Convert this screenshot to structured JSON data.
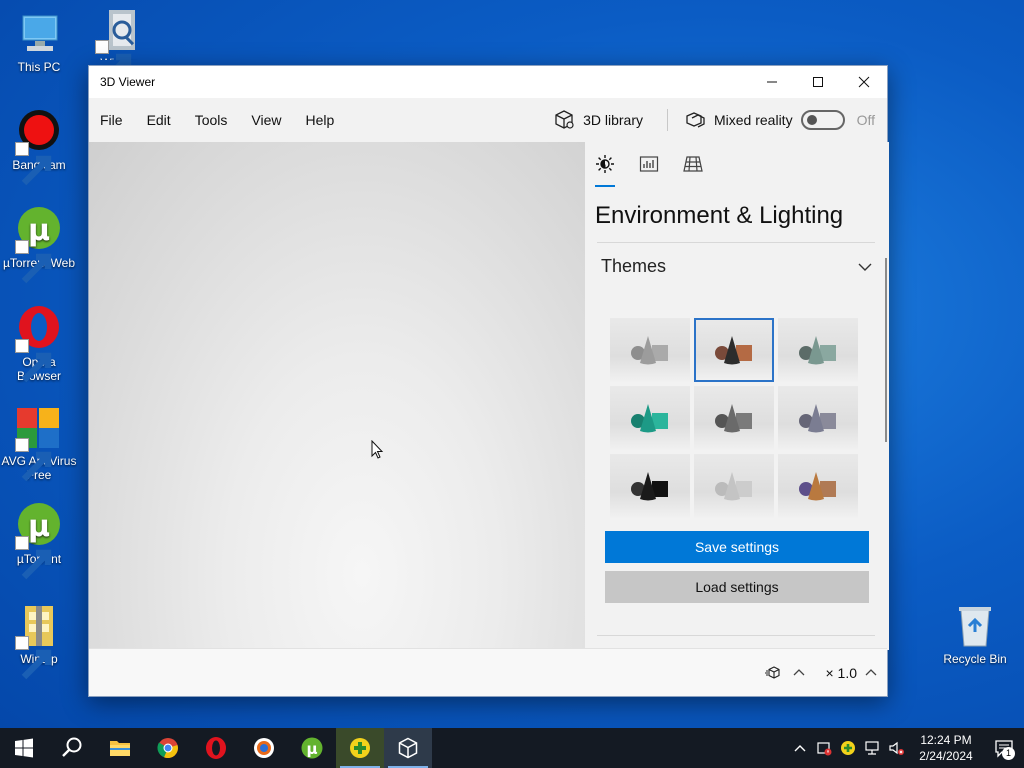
{
  "desktop": {
    "icons": [
      {
        "label": "This PC"
      },
      {
        "label": "WinZip"
      },
      {
        "label": "Bandicam"
      },
      {
        "label": "µTorrent Web"
      },
      {
        "label": "Opera Browser"
      },
      {
        "label": "AVG AntiVirus Free"
      },
      {
        "label": "µTorrent"
      },
      {
        "label": "WinZip"
      },
      {
        "label": "Recycle Bin"
      }
    ]
  },
  "window": {
    "title": "3D Viewer",
    "menu": [
      "File",
      "Edit",
      "Tools",
      "View",
      "Help"
    ],
    "library_label": "3D library",
    "mixed_reality_label": "Mixed reality",
    "toggle_state": "Off"
  },
  "panel": {
    "title": "Environment & Lighting",
    "section": "Themes",
    "save_label": "Save settings",
    "load_label": "Load settings",
    "selected_theme": 2,
    "themes": [
      {
        "primary": "#9c9c9c",
        "secondary": "#aaaaaa",
        "accent": "#8e8e8e"
      },
      {
        "primary": "#2c2c2c",
        "secondary": "#b46a44",
        "accent": "#7a4a3a"
      },
      {
        "primary": "#7a9890",
        "secondary": "#8aa8a0",
        "accent": "#5c6c68"
      },
      {
        "primary": "#1d9a86",
        "secondary": "#2bb59c",
        "accent": "#18806f"
      },
      {
        "primary": "#6a6a6a",
        "secondary": "#7a7a7a",
        "accent": "#555555"
      },
      {
        "primary": "#7b7d92",
        "secondary": "#8a8a9a",
        "accent": "#666677"
      },
      {
        "primary": "#1a1a1a",
        "secondary": "#111111",
        "accent": "#333333"
      },
      {
        "primary": "#c4c4c4",
        "secondary": "#cccccc",
        "accent": "#bbbbbb"
      },
      {
        "primary": "#b9793f",
        "secondary": "#b07a55",
        "accent": "#5d4f8a"
      }
    ]
  },
  "statusbar": {
    "zoom": "× 1.0"
  },
  "taskbar": {
    "time": "12:24 PM",
    "date": "2/24/2024",
    "notifications": "1"
  },
  "colors": {
    "accent": "#0078d7",
    "taskbar": "#141a23"
  }
}
